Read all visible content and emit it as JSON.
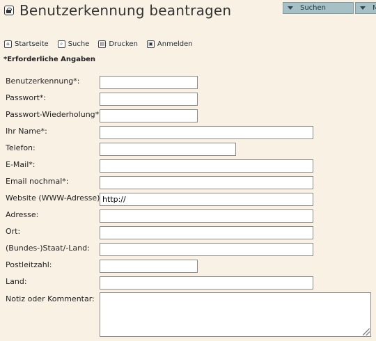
{
  "page": {
    "title": "Benutzerkennung beantragen"
  },
  "header_buttons": [
    {
      "label": "Suchen"
    },
    {
      "label": "M"
    }
  ],
  "nav": [
    {
      "label": "Startseite",
      "icon": "home-icon"
    },
    {
      "label": "Suche",
      "icon": "search-icon"
    },
    {
      "label": "Drucken",
      "icon": "print-icon"
    },
    {
      "label": "Anmelden",
      "icon": "lock-icon"
    }
  ],
  "required_note": "*Erforderliche Angaben",
  "form": {
    "fields": [
      {
        "label": "Benutzerkennung*:",
        "value": ""
      },
      {
        "label": "Passwort*:",
        "value": ""
      },
      {
        "label": "Passwort-Wiederholung*:",
        "value": ""
      },
      {
        "label": "Ihr Name*:",
        "value": ""
      },
      {
        "label": "Telefon:",
        "value": ""
      },
      {
        "label": "E-Mail*:",
        "value": ""
      },
      {
        "label": "Email nochmal*:",
        "value": ""
      },
      {
        "label": "Website (WWW-Adresse):",
        "value": "http://"
      },
      {
        "label": "Adresse:",
        "value": ""
      },
      {
        "label": "Ort:",
        "value": ""
      },
      {
        "label": "(Bundes-)Staat/-Land:",
        "value": ""
      },
      {
        "label": "Postleitzahl:",
        "value": ""
      },
      {
        "label": "Land:",
        "value": ""
      },
      {
        "label": "Notiz oder Kommentar:",
        "value": ""
      }
    ]
  },
  "colors": {
    "background": "#f8f1e4",
    "button_bg": "#a6c0c6"
  }
}
